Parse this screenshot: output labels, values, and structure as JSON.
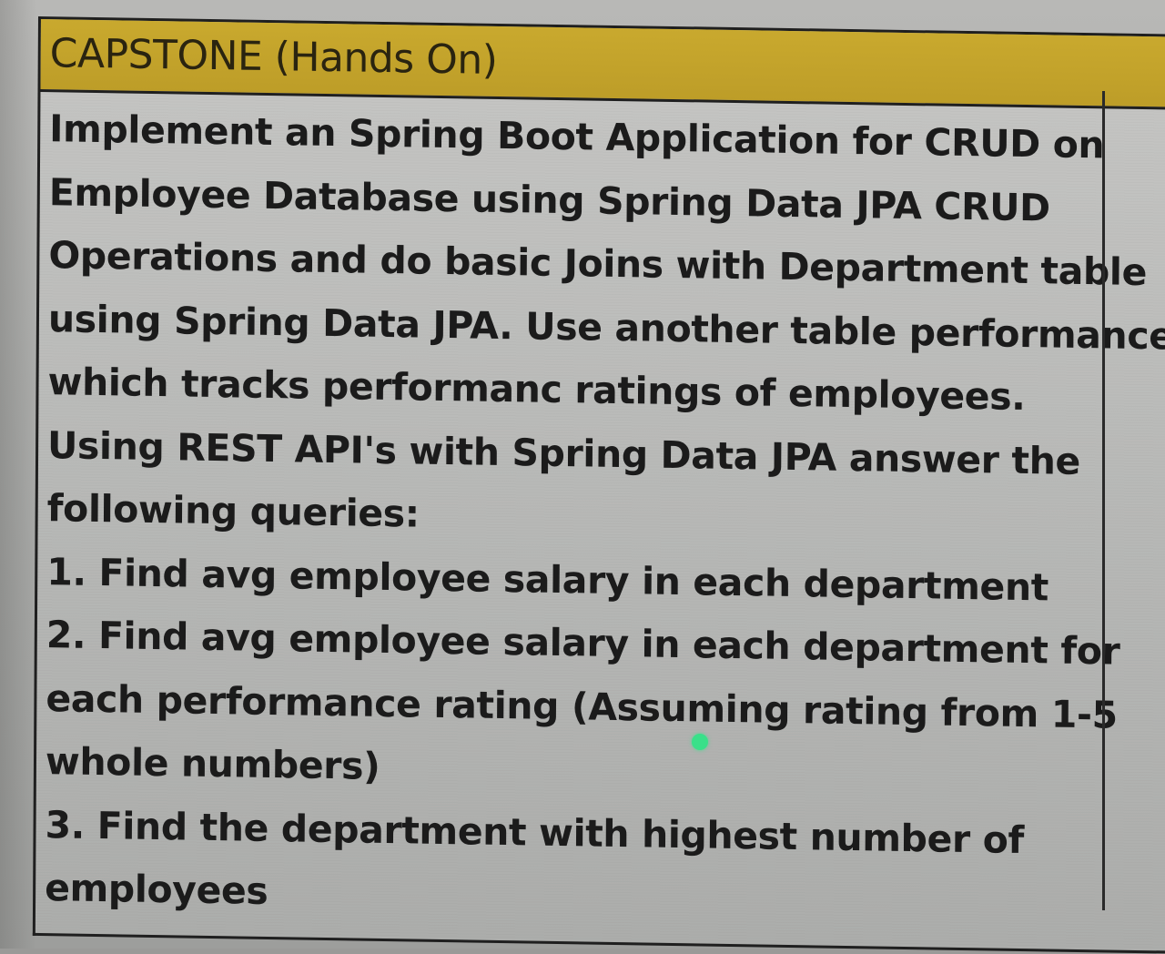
{
  "header": {
    "title": "CAPSTONE (Hands On)"
  },
  "content": {
    "lines": [
      "Implement an Spring Boot Application for CRUD on",
      "Employee Database using Spring Data JPA CRUD",
      "Operations and do basic Joins with Department table",
      "using Spring Data JPA. Use another table performance",
      "which tracks performanc ratings of employees.",
      "Using REST API's with Spring Data JPA answer the",
      "following queries:",
      "1. Find avg employee salary in each department",
      "2. Find avg employee salary in each department for",
      "each performance rating (Assuming rating from 1-5",
      "whole numbers)",
      "3. Find the department with highest number of",
      "employees"
    ]
  },
  "colors": {
    "header_background": "#c4a32b",
    "cell_background": "#b9bab8",
    "text": "#1b1b1b",
    "marker": "#39e089"
  }
}
